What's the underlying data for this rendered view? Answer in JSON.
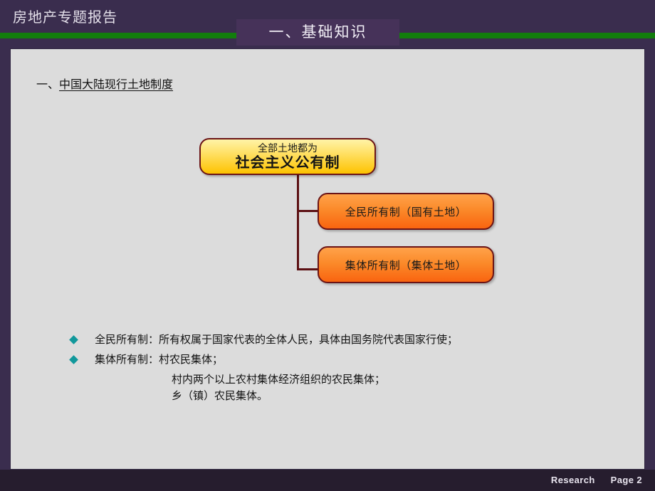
{
  "header": {
    "report_title": "房地产专题报告",
    "section_title": "一、基础知识",
    "band_color": "#3a2d4e",
    "title_box_color": "#463259",
    "accent_bar_color": "#127d0d"
  },
  "content": {
    "subsection_prefix": "一、",
    "subsection_title": "中国大陆现行土地制度",
    "background_color": "#dcdcdc"
  },
  "diagram": {
    "root": {
      "line1": "全部土地都为",
      "line2": "社会主义公有制",
      "fill_top": "#fff4a8",
      "fill_bottom": "#fdc300",
      "border_color": "#6b1416"
    },
    "children": [
      {
        "label": "全民所有制（国有土地）",
        "fill_top": "#ffa24a",
        "fill_bottom": "#f96410",
        "border_color": "#6b1416"
      },
      {
        "label": "集体所有制（集体土地）",
        "fill_top": "#ffa24a",
        "fill_bottom": "#f96410",
        "border_color": "#6b1416"
      }
    ],
    "connector_color": "#5c1013"
  },
  "bullets": {
    "marker_color": "#11989b",
    "items": [
      {
        "text": "全民所有制：所有权属于国家代表的全体人民，具体由国务院代表国家行使；",
        "continuations": []
      },
      {
        "text": "集体所有制：村农民集体；",
        "continuations": [
          "村内两个以上农村集体经济组织的农民集体；",
          "乡（镇）农民集体。"
        ]
      }
    ]
  },
  "footer": {
    "brand": "Research",
    "page": "Page 2",
    "background_color": "#261d2e"
  }
}
